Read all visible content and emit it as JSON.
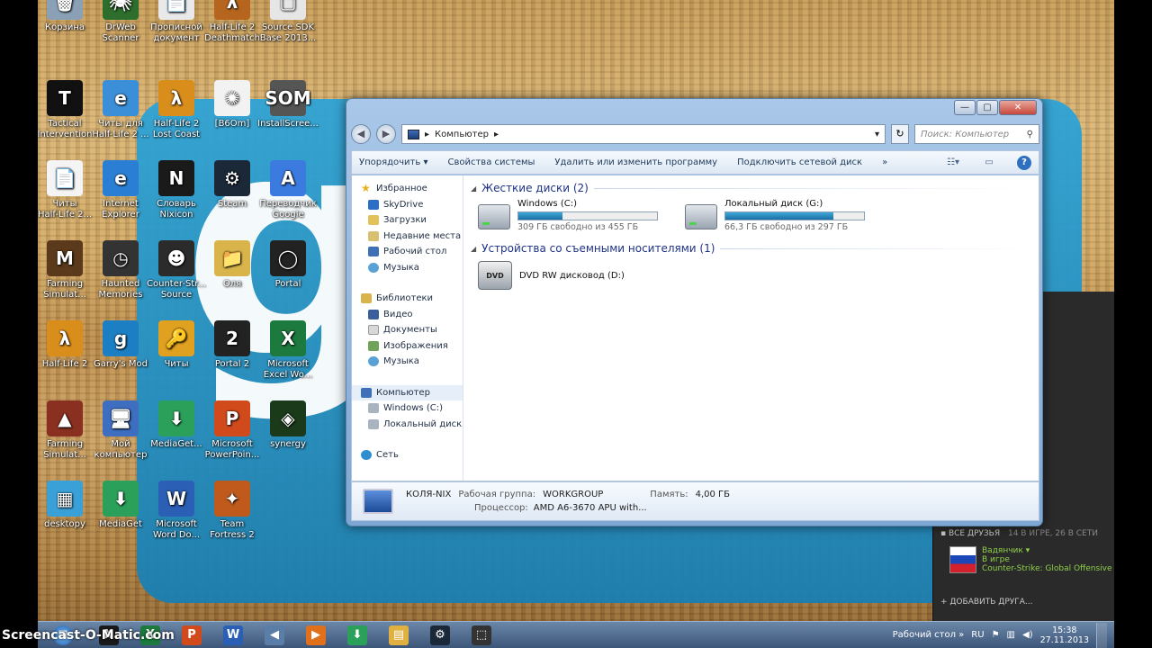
{
  "desktop": {
    "icons": [
      {
        "label": "Корзина",
        "color": "#8aa0b5",
        "glyph": "🗑"
      },
      {
        "label": "DrWeb\nScanner",
        "color": "#2d6e2d",
        "glyph": "🕷"
      },
      {
        "label": "Прописной\nдокумент",
        "color": "#e9e9e9",
        "glyph": "📄"
      },
      {
        "label": "Half-Life 2\nDeathmatch",
        "color": "#b5651d",
        "glyph": "λ"
      },
      {
        "label": "Source SDK\nBase 2013...",
        "color": "#e6e6e6",
        "glyph": "▢"
      },
      {
        "label": "Tactical\nIntervention",
        "color": "#111111",
        "glyph": "T"
      },
      {
        "label": "Читы для\nHalf-Life 2 ...",
        "color": "#3b8fd9",
        "glyph": "e"
      },
      {
        "label": "Half-Life 2\nLost Coast",
        "color": "#d98d1b",
        "glyph": "λ"
      },
      {
        "label": "[B6Om]",
        "color": "#f2f2f2",
        "glyph": "✺"
      },
      {
        "label": "InstallScree...",
        "color": "#555555",
        "glyph": "SOM"
      },
      {
        "label": "Читы\nHalf-Life 2...",
        "color": "#f4f4f4",
        "glyph": "📄"
      },
      {
        "label": "Internet\nExplorer",
        "color": "#2a7fd4",
        "glyph": "e"
      },
      {
        "label": "Словарь\nNixicon",
        "color": "#1a1a1a",
        "glyph": "N"
      },
      {
        "label": "Steam",
        "color": "#1b2838",
        "glyph": "⚙"
      },
      {
        "label": "Переводчик\nGoogle",
        "color": "#3b7be0",
        "glyph": "A"
      },
      {
        "label": "Farming\nSimulat...",
        "color": "#5a3a1a",
        "glyph": "M"
      },
      {
        "label": "Haunted\nMemories",
        "color": "#333333",
        "glyph": "◷"
      },
      {
        "label": "Counter-Str...\nSource",
        "color": "#2b2b2b",
        "glyph": "☻"
      },
      {
        "label": "Оля",
        "color": "#d9b44a",
        "glyph": "📁"
      },
      {
        "label": "Portal",
        "color": "#222222",
        "glyph": "◯"
      },
      {
        "label": "Half-Life 2",
        "color": "#d98d1b",
        "glyph": "λ"
      },
      {
        "label": "Garry's Mod",
        "color": "#1c7fc4",
        "glyph": "g"
      },
      {
        "label": "Читы",
        "color": "#e0a020",
        "glyph": "🔑"
      },
      {
        "label": "Portal 2",
        "color": "#222222",
        "glyph": "2"
      },
      {
        "label": "Microsoft\nExcel Wo...",
        "color": "#1d7a3e",
        "glyph": "X"
      },
      {
        "label": "Farming\nSimulat...",
        "color": "#8a3020",
        "glyph": "▲"
      },
      {
        "label": "Мой\nкомпьютер",
        "color": "#3d6ec0",
        "glyph": "🖥"
      },
      {
        "label": "MediaGet...",
        "color": "#2aa05a",
        "glyph": "⬇"
      },
      {
        "label": "Microsoft\nPowerPoin...",
        "color": "#d04a1c",
        "glyph": "P"
      },
      {
        "label": "synergy",
        "color": "#1a3a1a",
        "glyph": "◈"
      },
      {
        "label": "desktopy",
        "color": "#3aa0d8",
        "glyph": "▦"
      },
      {
        "label": "MediaGet",
        "color": "#2aa05a",
        "glyph": "⬇"
      },
      {
        "label": "Microsoft\nWord Do...",
        "color": "#2b5fb5",
        "glyph": "W"
      },
      {
        "label": "Team\nFortress 2",
        "color": "#c05a1c",
        "glyph": "✦"
      }
    ]
  },
  "explorer": {
    "title_buttons": {
      "min": "—",
      "max": "▢",
      "close": "✕"
    },
    "address": "Компьютер",
    "search_placeholder": "Поиск: Компьютер",
    "toolbar": [
      "Упорядочить ▾",
      "Свойства системы",
      "Удалить или изменить программу",
      "Подключить сетевой диск",
      "»"
    ],
    "nav": {
      "favorites": "Избранное",
      "fav_items": [
        "SkyDrive",
        "Загрузки",
        "Недавние места",
        "Рабочий стол",
        "Музыка"
      ],
      "libraries": "Библиотеки",
      "lib_items": [
        "Видео",
        "Документы",
        "Изображения",
        "Музыка"
      ],
      "computer": "Компьютер",
      "comp_items": [
        "Windows (C:)",
        "Локальный диск ("
      ],
      "network": "Сеть"
    },
    "groups": {
      "hdd": "Жесткие диски (2)",
      "removable": "Устройства со съемными носителями (1)"
    },
    "drives": [
      {
        "name": "Windows (C:)",
        "free": "309 ГБ свободно из 455 ГБ",
        "used_fraction": 0.32
      },
      {
        "name": "Локальный диск (G:)",
        "free": "66,3 ГБ свободно из 297 ГБ",
        "used_fraction": 0.78
      }
    ],
    "dvd": {
      "name": "DVD RW дисковод (D:)",
      "badge": "DVD"
    },
    "details": {
      "pc_name": "КОЛЯ-NIX",
      "workgroup_label": "Рабочая группа:",
      "workgroup": "WORKGROUP",
      "memory_label": "Память:",
      "memory": "4,00 ГБ",
      "cpu_label": "Процессор:",
      "cpu": "AMD A6-3670 APU with..."
    }
  },
  "steam": {
    "all_friends": "▪ ВСЕ ДРУЗЬЯ",
    "counts": "14 В ИГРЕ, 26 В СЕТИ",
    "friend_name": "Вадянчик ▾",
    "friend_status": "В игре",
    "friend_game": "Counter-Strike: Global Offensive",
    "add_friend": "+ ДОБАВИТЬ ДРУГА..."
  },
  "taskbar": {
    "watermark": "Screencast-O-Matic.com",
    "apps": [
      {
        "name": "nixicon",
        "glyph": "N",
        "color": "#1a1a1a"
      },
      {
        "name": "excel",
        "glyph": "X",
        "color": "#1d7a3e"
      },
      {
        "name": "powerpoint",
        "glyph": "P",
        "color": "#d04a1c"
      },
      {
        "name": "word",
        "glyph": "W",
        "color": "#2b5fb5"
      },
      {
        "name": "volume",
        "glyph": "◀",
        "color": "#5a7ea8"
      },
      {
        "name": "media",
        "glyph": "▶",
        "color": "#e0701c"
      },
      {
        "name": "mediaget",
        "glyph": "⬇",
        "color": "#2aa05a"
      },
      {
        "name": "explorer",
        "glyph": "▤",
        "color": "#e0b040"
      },
      {
        "name": "steam",
        "glyph": "⚙",
        "color": "#1b2838"
      },
      {
        "name": "snipping",
        "glyph": "⬚",
        "color": "#333333"
      }
    ],
    "desktop_label": "Рабочий стол »",
    "lang": "RU",
    "time": "15:38",
    "date": "27.11.2013"
  }
}
